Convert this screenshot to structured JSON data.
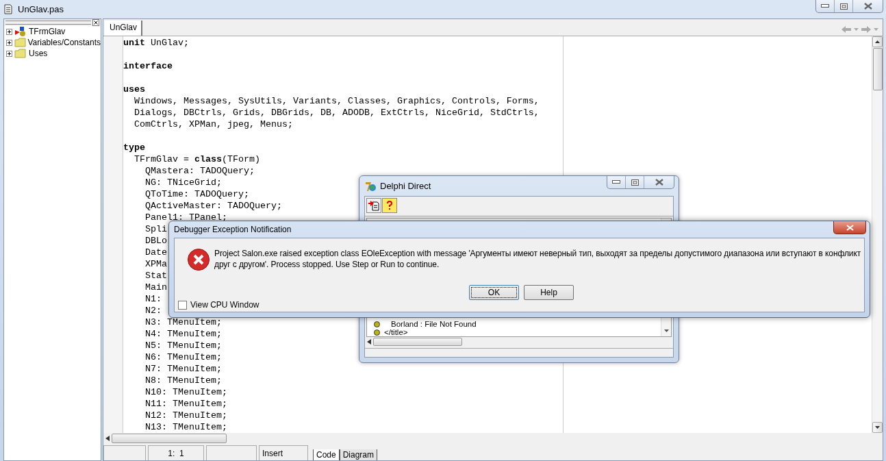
{
  "window": {
    "title": "UnGlav.pas"
  },
  "explorer": {
    "items": [
      {
        "label": "TFrmGlav",
        "kind": "class",
        "expanded": false
      },
      {
        "label": "Variables/Constants",
        "kind": "folder",
        "expanded": false
      },
      {
        "label": "Uses",
        "kind": "folder",
        "expanded": false
      }
    ]
  },
  "editor_tabs": [
    {
      "label": "UnGlav",
      "selected": true
    }
  ],
  "code_lines": [
    {
      "text": "**unit** UnGlav;"
    },
    {
      "text": "**interface**",
      "gap_before": true
    },
    {
      "text": "**uses**",
      "gap_before": true
    },
    {
      "text": "  Windows, Messages, SysUtils, Variants, Classes, Graphics, Controls, Forms,"
    },
    {
      "text": "  Dialogs, DBCtrls, Grids, DBGrids, DB, ADODB, ExtCtrls, NiceGrid, StdCtrls,"
    },
    {
      "text": "  ComCtrls, XPMan, jpeg, Menus;"
    },
    {
      "text": "**type**",
      "gap_before": true
    },
    {
      "text": "  TFrmGlav = **class**(TForm)"
    },
    {
      "text": "    QMastera: TADOQuery;"
    },
    {
      "text": "    NG: TNiceGrid;"
    },
    {
      "text": "    QToTime: TADOQuery;"
    },
    {
      "text": "    QActiveMaster: TADOQuery;"
    },
    {
      "text": "    Panel1: TPanel;"
    },
    {
      "text": "    Spli"
    },
    {
      "text": "    DBLo"
    },
    {
      "text": "    Date"
    },
    {
      "text": "    XPMa"
    },
    {
      "text": "    Stat"
    },
    {
      "text": "    Main"
    },
    {
      "text": "    N1:"
    },
    {
      "text": "    N2:"
    },
    {
      "text": "    N3: TMenuItem;"
    },
    {
      "text": "    N4: TMenuItem;"
    },
    {
      "text": "    N5: TMenuItem;"
    },
    {
      "text": "    N6: TMenuItem;"
    },
    {
      "text": "    N7: TMenuItem;"
    },
    {
      "text": "    N8: TMenuItem;"
    },
    {
      "text": "    N10: TMenuItem;"
    },
    {
      "text": "    N11: TMenuItem;"
    },
    {
      "text": "    N12: TMenuItem;"
    },
    {
      "text": "    N13: TMenuItem;"
    }
  ],
  "status_bar": {
    "position": "1:  1",
    "mode": "Insert"
  },
  "view_tabs": [
    {
      "label": "Code",
      "selected": true
    },
    {
      "label": "Diagram",
      "selected": false
    }
  ],
  "delphi_direct": {
    "title": "Delphi Direct",
    "tree_items": [
      "Borland : File Not Found",
      "</title>"
    ]
  },
  "dialog": {
    "title": "Debugger Exception Notification",
    "message": "Project Salon.exe raised exception class EOleException with message 'Аргументы имеют неверный тип, выходят за пределы допустимого диапазона или вступают в конфликт друг с другом'. Process stopped. Use Step or Run to continue.",
    "buttons": [
      {
        "label": "OK",
        "default": true
      },
      {
        "label": "Help",
        "default": false
      }
    ],
    "checkbox": {
      "label": "View CPU Window",
      "checked": false
    }
  }
}
